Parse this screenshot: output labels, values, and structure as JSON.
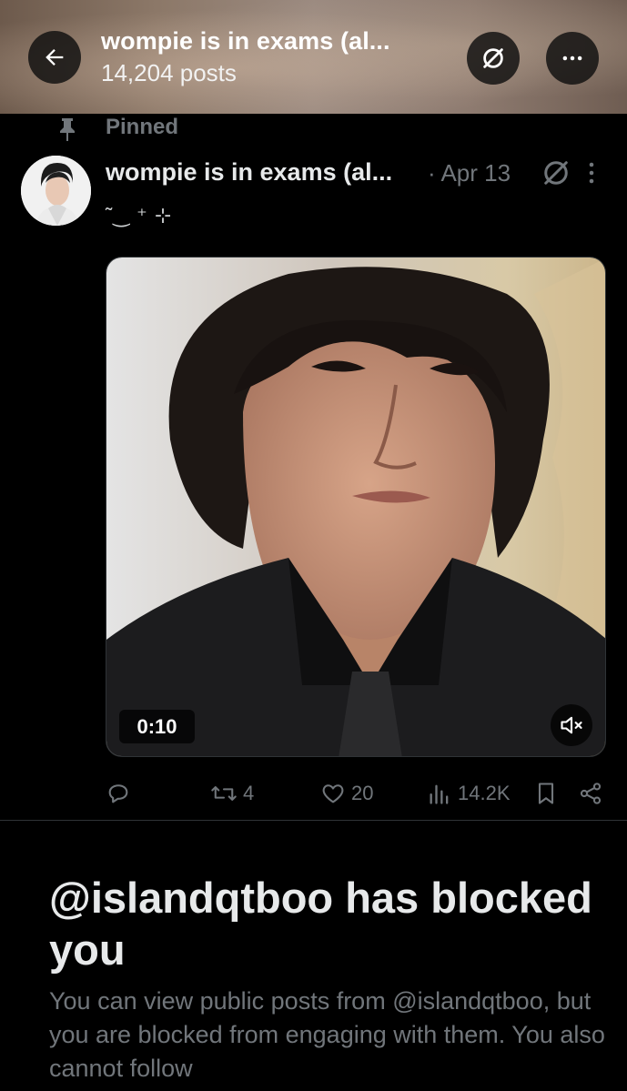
{
  "header": {
    "title": "wompie is in exams (al...",
    "posts_count": "14,204 posts",
    "back_icon": "arrow-left-icon",
    "hide_icon": "circle-slash-icon",
    "more_icon": "more-horizontal-icon"
  },
  "pinned": {
    "label": "Pinned",
    "icon": "pin-icon"
  },
  "post": {
    "author": "wompie is in exams (al...",
    "date": "· Apr 13",
    "text": "˜‿ ⁺ ⊹",
    "video": {
      "duration": "0:10",
      "mute_icon": "volume-muted-icon"
    },
    "actions": {
      "reply_icon": "reply-icon",
      "reposts": "4",
      "likes": "20",
      "views": "14.2K",
      "bookmark_icon": "bookmark-icon",
      "share_icon": "share-icon"
    }
  },
  "blocked": {
    "title": "@islandqtboo has blocked you",
    "body": "You can view public posts from @islandqtboo, but you are blocked from engaging with them. You also cannot follow"
  },
  "colors": {
    "muted": "#71767b",
    "text": "#e7e9ea",
    "background": "#000000"
  }
}
